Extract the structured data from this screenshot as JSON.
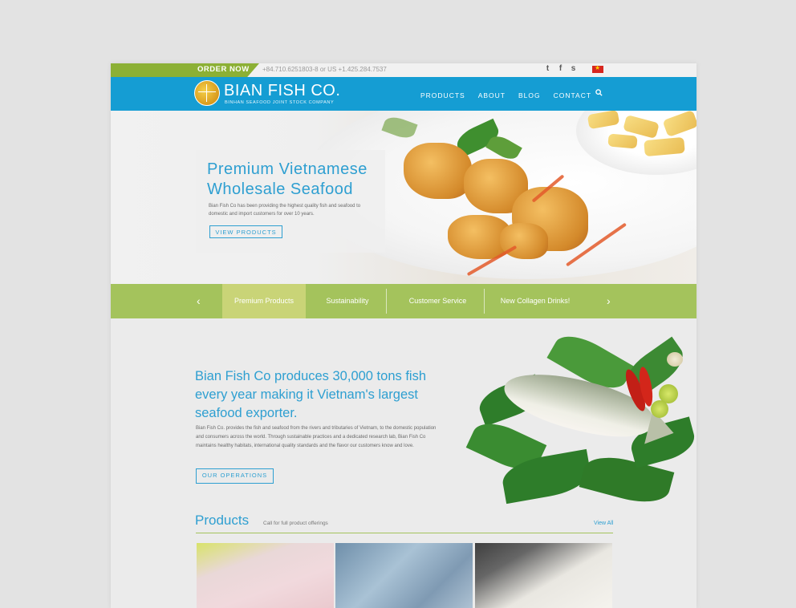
{
  "topbar": {
    "order_now": "ORDER NOW",
    "phones": "+84.710.6251803-8   or US +1.425.284.7537",
    "social_icons": [
      "twitter-icon",
      "facebook-icon",
      "skype-icon"
    ],
    "flag": "vietnam-flag"
  },
  "header": {
    "logo_title": "BIAN FISH CO.",
    "logo_subtitle": "BINHAN SEAFOOD JOINT STOCK COMPANY",
    "nav": [
      "PRODUCTS",
      "ABOUT",
      "BLOG",
      "CONTACT"
    ],
    "search_icon": "search-icon"
  },
  "hero": {
    "title": "Premium Vietnamese Wholesale Seafood",
    "description": "Bian Fish Co has been providing the highest quality fish and seafood to domestic and import customers for over 10 years.",
    "button": "VIEW PRODUCTS"
  },
  "slider_tabs": {
    "prev": "‹",
    "next": "›",
    "items": [
      "Premium Products",
      "Sustainability",
      "Customer Service",
      "New Collagen Drinks!"
    ],
    "active_index": 0
  },
  "about": {
    "title": "Bian Fish Co produces 30,000 tons fish every year making it Vietnam's largest seafood exporter.",
    "text": "Bian Fish Co. provides the fish and seafood from the rivers and tributaries of Vietnam, to the domestic population and consumers across the world. Through sustainable practices and a dedicated research lab, Bian Fish Co maintains healthy habitats, international quality standards and the flavor our customers know and love.",
    "button": "OUR OPERATIONS"
  },
  "products": {
    "heading": "Products",
    "subheading": "Call for full product offerings",
    "view_all": "View All"
  },
  "colors": {
    "brand_blue": "#159dd3",
    "accent_green": "#a4c35c",
    "order_green": "#8cb035",
    "text_blue": "#2e9fd1"
  }
}
